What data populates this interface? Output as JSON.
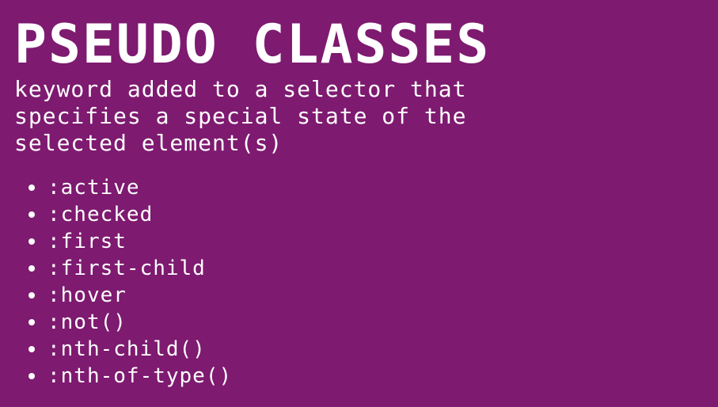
{
  "slide": {
    "title": "PSEUDO CLASSES",
    "subtitle": "keyword added to a selector that specifies a special state of the selected element(s)",
    "items": [
      ":active",
      ":checked",
      ":first",
      ":first-child",
      ":hover",
      ":not()",
      ":nth-child()",
      ":nth-of-type()"
    ]
  },
  "colors": {
    "background": "#7e1a70",
    "text": "#ffffff"
  }
}
